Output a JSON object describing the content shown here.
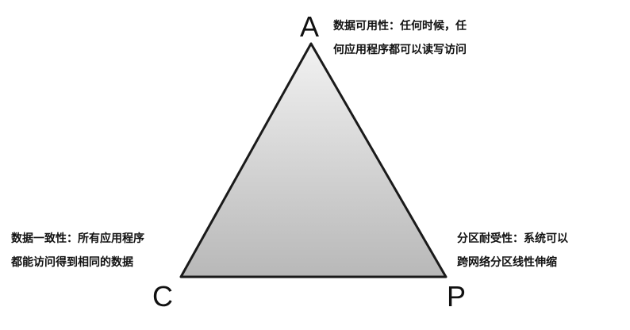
{
  "diagram": {
    "colors": {
      "edge": "#1a1a1a",
      "fill_top": "#f2f2f2",
      "fill_bottom": "#b8b8b8"
    },
    "vertices": {
      "a": {
        "label": "A"
      },
      "c": {
        "label": "C"
      },
      "p": {
        "label": "P"
      }
    },
    "descriptions": {
      "a": [
        "数据可用性：任何时候，任",
        "何应用程序都可以读写访问"
      ],
      "c": [
        "数据一致性：所有应用程序",
        "都能访问得到相同的数据"
      ],
      "p": [
        "分区耐受性：系统可以",
        "跨网络分区线性伸缩"
      ]
    }
  }
}
